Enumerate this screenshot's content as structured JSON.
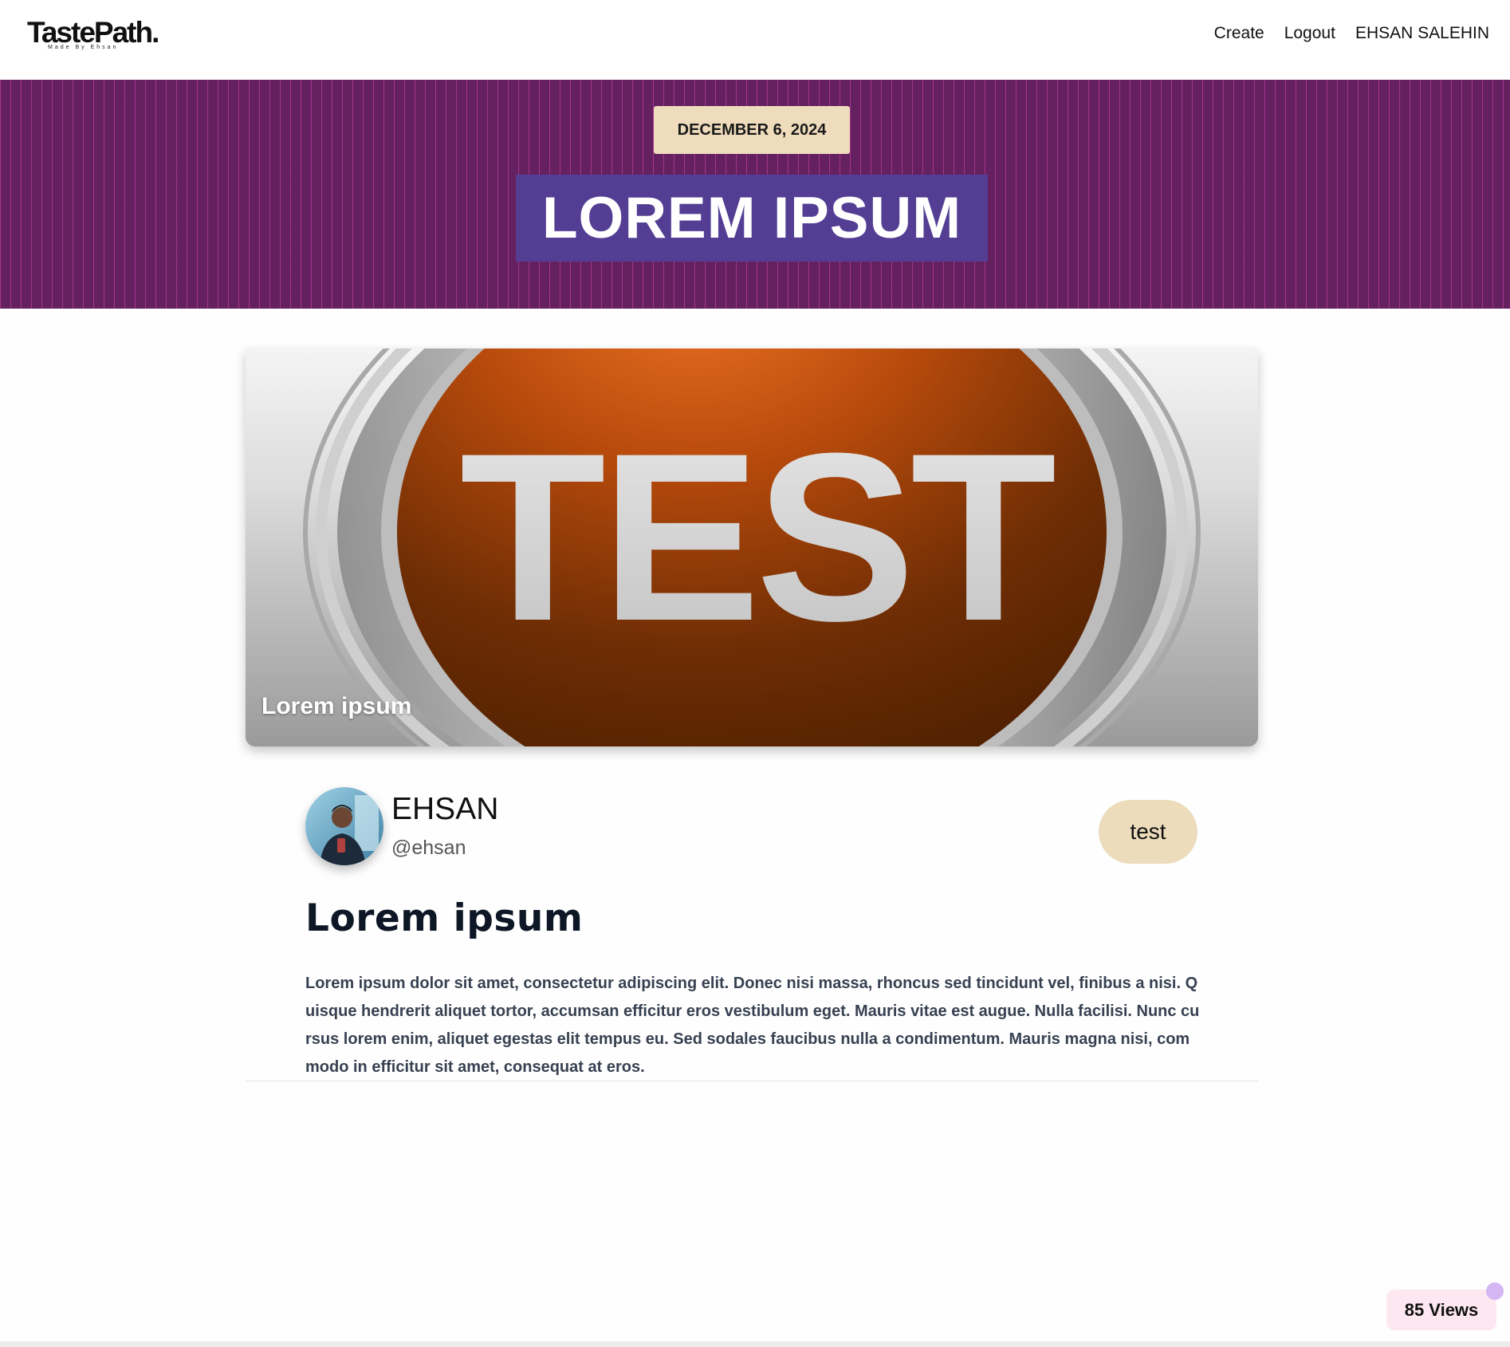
{
  "header": {
    "logo_text": "TastePath.",
    "logo_subtext": "Made By Ehsan",
    "nav": [
      {
        "label": "Create"
      },
      {
        "label": "Logout"
      },
      {
        "label": "EHSAN SALEHIN"
      }
    ]
  },
  "hero": {
    "date": "DECEMBER 6, 2024",
    "title": "LOREM IPSUM"
  },
  "cover": {
    "image_text": "TEST",
    "caption": "Lorem ipsum"
  },
  "author": {
    "name": "EHSAN",
    "handle": "@ehsan"
  },
  "tag": "test",
  "post": {
    "title": "Lorem ipsum",
    "body": "Lorem ipsum dolor sit amet, consectetur adipiscing elit. Donec nisi massa, rhoncus sed tincidunt vel, finibus a nisi. Quisque hendrerit aliquet tortor, accumsan efficitur eros vestibulum eget. Mauris vitae est augue. Nulla facilisi. Nunc cursus lorem enim, aliquet egestas elit tempus eu. Sed sodales faucibus nulla a condimentum. Mauris magna nisi, commodo in efficitur sit amet, consequat at eros."
  },
  "views": "85 Views",
  "colors": {
    "hero_bg": "#65215f",
    "hero_title_bg": "#533e94",
    "badge_bg": "#efdcbc",
    "views_bg": "#fde8f1"
  }
}
